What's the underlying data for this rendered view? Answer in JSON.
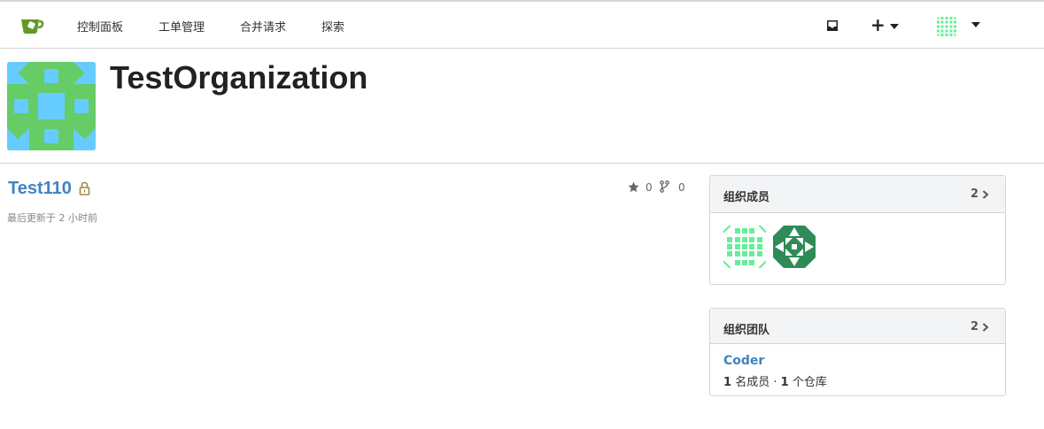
{
  "nav": {
    "items": [
      "控制面板",
      "工单管理",
      "合并请求",
      "探索"
    ],
    "plus": "+"
  },
  "org": {
    "name": "TestOrganization"
  },
  "repo": {
    "name": "Test110",
    "updated": "最后更新于 2 小时前",
    "stars": "0",
    "forks": "0"
  },
  "members_panel": {
    "title": "组织成员",
    "count": "2"
  },
  "teams_panel": {
    "title": "组织团队",
    "count": "2",
    "team": {
      "name": "Coder",
      "member_count": "1",
      "member_label": "名成员",
      "separator": "·",
      "repo_count": "1",
      "repo_label": "个仓库"
    }
  },
  "colors": {
    "link": "#4183c4",
    "avatar_green": "#66cc66",
    "avatar_blue": "#66ccff",
    "lock": "#a08a3c"
  }
}
